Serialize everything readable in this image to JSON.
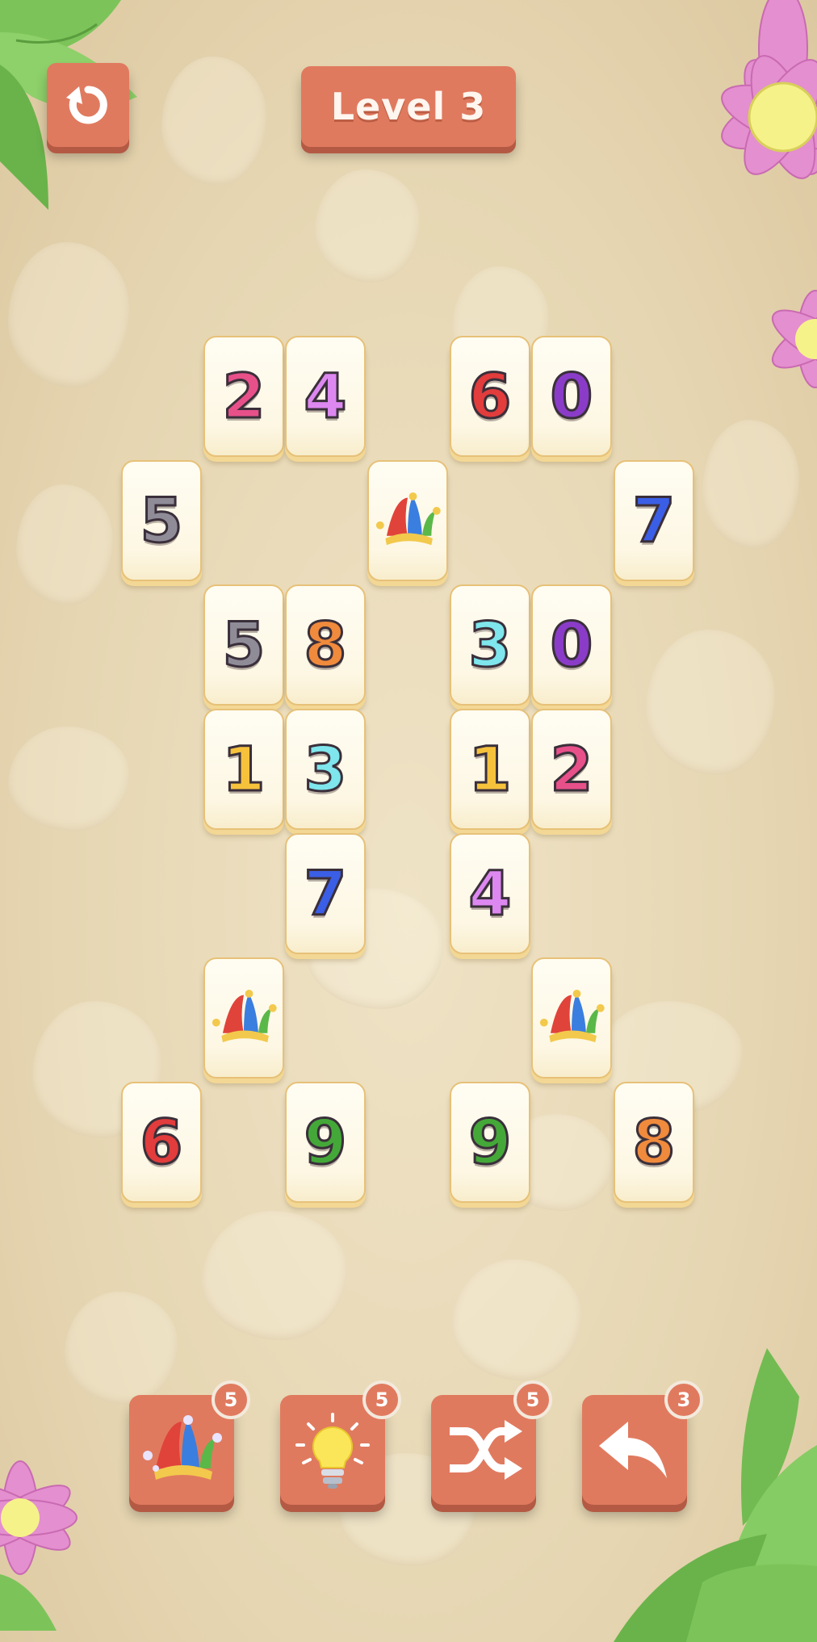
{
  "header": {
    "restart_icon": "restart-arrow-icon",
    "level_label": "Level 3"
  },
  "tiles": [
    {
      "kind": "digit",
      "value": "2",
      "color": "#e8508a"
    },
    {
      "kind": "digit",
      "value": "4",
      "color": "#dd88f0"
    },
    {
      "kind": "digit",
      "value": "6",
      "color": "#e23c3c"
    },
    {
      "kind": "digit",
      "value": "0",
      "color": "#8a3cc8"
    },
    {
      "kind": "digit",
      "value": "5",
      "color": "#8f8c98"
    },
    {
      "kind": "joker",
      "icon": "jester-hat-icon"
    },
    {
      "kind": "digit",
      "value": "7",
      "color": "#3a5ee6"
    },
    {
      "kind": "digit",
      "value": "5",
      "color": "#8f8c98"
    },
    {
      "kind": "digit",
      "value": "8",
      "color": "#f08a3c"
    },
    {
      "kind": "digit",
      "value": "3",
      "color": "#7ee6ec"
    },
    {
      "kind": "digit",
      "value": "0",
      "color": "#8a3cc8"
    },
    {
      "kind": "digit",
      "value": "1",
      "color": "#f6c23c"
    },
    {
      "kind": "digit",
      "value": "3",
      "color": "#7ee6ec"
    },
    {
      "kind": "digit",
      "value": "1",
      "color": "#f6c23c"
    },
    {
      "kind": "digit",
      "value": "2",
      "color": "#e8508a"
    },
    {
      "kind": "digit",
      "value": "7",
      "color": "#3a5ee6"
    },
    {
      "kind": "digit",
      "value": "4",
      "color": "#dd88f0"
    },
    {
      "kind": "joker",
      "icon": "jester-hat-icon"
    },
    {
      "kind": "joker",
      "icon": "jester-hat-icon"
    },
    {
      "kind": "digit",
      "value": "6",
      "color": "#e23c3c"
    },
    {
      "kind": "digit",
      "value": "9",
      "color": "#44a838"
    },
    {
      "kind": "digit",
      "value": "9",
      "color": "#44a838"
    },
    {
      "kind": "digit",
      "value": "8",
      "color": "#f08a3c"
    }
  ],
  "tools": [
    {
      "name": "joker",
      "icon": "jester-hat-icon",
      "count": "5"
    },
    {
      "name": "hint",
      "icon": "lightbulb-icon",
      "count": "5"
    },
    {
      "name": "shuffle",
      "icon": "shuffle-icon",
      "count": "5"
    },
    {
      "name": "undo",
      "icon": "undo-arrow-icon",
      "count": "3"
    }
  ],
  "colors": {
    "button": "#e07a5f",
    "button_shadow": "#b45a44",
    "tile_border": "#e7c178",
    "background": "#e6d6b2"
  }
}
